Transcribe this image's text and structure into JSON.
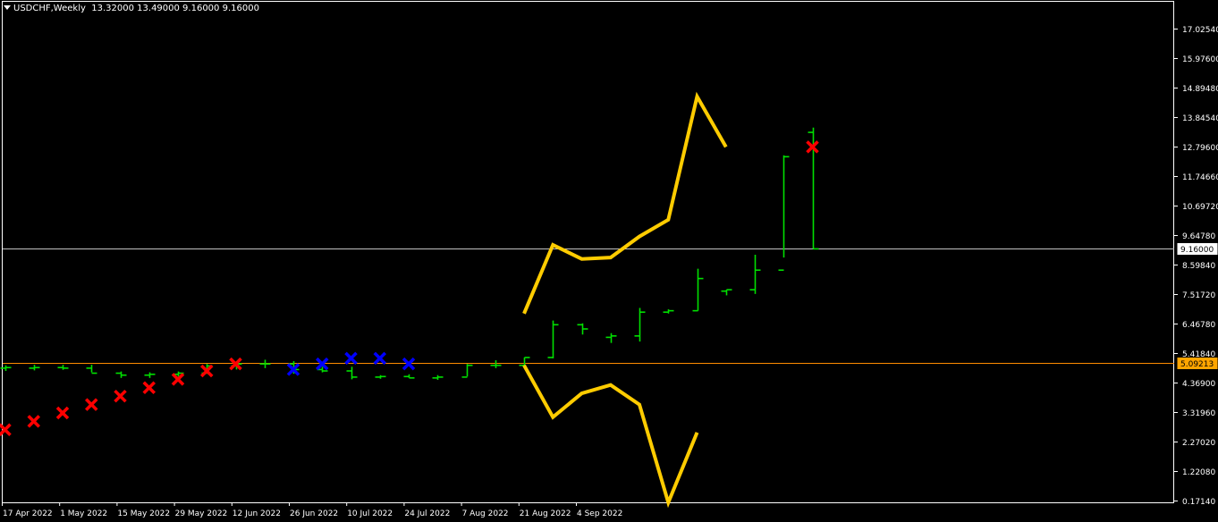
{
  "header": {
    "symbol": "USDCHF,Weekly",
    "ohlc": "13.32000 13.49000 9.16000 9.16000"
  },
  "colors": {
    "background": "#000000",
    "frame": "#ffffff",
    "bars": "#00e000",
    "bands": "#ffcc00",
    "sar_red": "#ff0000",
    "sar_blue": "#0000ff",
    "bid_line": "#c0c0c0",
    "ref_line": "#ff8c00",
    "label_highlight": "#ffa500"
  },
  "chart_data": {
    "type": "ohlc",
    "y_ticks": [
      "17.02540",
      "15.97600",
      "14.89480",
      "13.84540",
      "12.79600",
      "11.74660",
      "10.69720",
      "9.64780",
      "8.59840",
      "7.51720",
      "6.46780",
      "5.41840",
      "4.36900",
      "3.31960",
      "2.27020",
      "1.22080",
      "0.17140"
    ],
    "ylim": [
      0.0,
      18.0
    ],
    "x_labels": [
      "17 Apr 2022",
      "1 May 2022",
      "15 May 2022",
      "29 May 2022",
      "12 Jun 2022",
      "26 Jun 2022",
      "10 Jul 2022",
      "24 Jul 2022",
      "7 Aug 2022",
      "21 Aug 2022",
      "4 Sep 2022"
    ],
    "bars": [
      {
        "o": 4.9,
        "h": 5.0,
        "l": 4.8,
        "c": 4.92
      },
      {
        "o": 4.9,
        "h": 5.02,
        "l": 4.82,
        "c": 4.92
      },
      {
        "o": 4.92,
        "h": 5.02,
        "l": 4.84,
        "c": 4.9
      },
      {
        "o": 4.9,
        "h": 5.02,
        "l": 4.75,
        "c": 4.72
      },
      {
        "o": 4.72,
        "h": 4.78,
        "l": 4.55,
        "c": 4.65
      },
      {
        "o": 4.65,
        "h": 4.75,
        "l": 4.55,
        "c": 4.68
      },
      {
        "o": 4.68,
        "h": 4.78,
        "l": 4.6,
        "c": 4.72
      },
      {
        "o": 4.72,
        "h": 5.05,
        "l": 4.7,
        "c": 4.98
      },
      {
        "o": 4.98,
        "h": 5.1,
        "l": 4.85,
        "c": 5.05
      },
      {
        "o": 5.05,
        "h": 5.2,
        "l": 4.9,
        "c": 5.05
      },
      {
        "o": 5.05,
        "h": 5.15,
        "l": 4.7,
        "c": 4.85
      },
      {
        "o": 4.85,
        "h": 4.95,
        "l": 4.75,
        "c": 4.8
      },
      {
        "o": 4.8,
        "h": 4.95,
        "l": 4.5,
        "c": 4.58
      },
      {
        "o": 4.58,
        "h": 4.65,
        "l": 4.52,
        "c": 4.6
      },
      {
        "o": 4.6,
        "h": 4.68,
        "l": 4.55,
        "c": 4.55
      },
      {
        "o": 4.55,
        "h": 4.65,
        "l": 4.48,
        "c": 4.58
      },
      {
        "o": 4.58,
        "h": 5.05,
        "l": 4.6,
        "c": 5.0
      },
      {
        "o": 5.0,
        "h": 5.18,
        "l": 4.9,
        "c": 5.0
      },
      {
        "o": 5.0,
        "h": 5.28,
        "l": 4.95,
        "c": 5.28
      },
      {
        "o": 5.28,
        "h": 6.6,
        "l": 5.25,
        "c": 6.45
      },
      {
        "o": 6.45,
        "h": 6.5,
        "l": 6.1,
        "c": 6.3
      },
      {
        "o": 6.0,
        "h": 6.15,
        "l": 5.8,
        "c": 6.05
      },
      {
        "o": 6.05,
        "h": 7.05,
        "l": 5.85,
        "c": 6.9
      },
      {
        "o": 6.9,
        "h": 7.0,
        "l": 6.85,
        "c": 6.95
      },
      {
        "o": 6.95,
        "h": 8.45,
        "l": 6.95,
        "c": 8.1
      },
      {
        "o": 7.65,
        "h": 7.7,
        "l": 7.5,
        "c": 7.7
      },
      {
        "o": 7.7,
        "h": 8.95,
        "l": 7.55,
        "c": 8.4
      },
      {
        "o": 8.4,
        "h": 12.5,
        "l": 8.85,
        "c": 12.45
      },
      {
        "o": 13.32,
        "h": 13.49,
        "l": 9.16,
        "c": 9.16
      }
    ],
    "upper_band": [
      {
        "i": 18.0,
        "v": 6.85
      },
      {
        "i": 19.0,
        "v": 9.3
      },
      {
        "i": 20.0,
        "v": 8.8
      },
      {
        "i": 21.0,
        "v": 8.85
      },
      {
        "i": 22.0,
        "v": 9.6
      },
      {
        "i": 23.0,
        "v": 10.2
      },
      {
        "i": 24.0,
        "v": 14.6
      },
      {
        "i": 25.0,
        "v": 12.8
      }
    ],
    "lower_band": [
      {
        "i": 18.0,
        "v": 5.0
      },
      {
        "i": 19.0,
        "v": 3.15
      },
      {
        "i": 20.0,
        "v": 4.0
      },
      {
        "i": 21.0,
        "v": 4.3
      },
      {
        "i": 22.0,
        "v": 3.6
      },
      {
        "i": 23.0,
        "v": 0.1
      },
      {
        "i": 24.0,
        "v": 2.6
      }
    ],
    "sar": [
      {
        "i": 0,
        "v": 2.7,
        "color": "red"
      },
      {
        "i": 1,
        "v": 3.0,
        "color": "red"
      },
      {
        "i": 2,
        "v": 3.3,
        "color": "red"
      },
      {
        "i": 3,
        "v": 3.6,
        "color": "red"
      },
      {
        "i": 4,
        "v": 3.9,
        "color": "red"
      },
      {
        "i": 5,
        "v": 4.2,
        "color": "red"
      },
      {
        "i": 6,
        "v": 4.5,
        "color": "red"
      },
      {
        "i": 7,
        "v": 4.8,
        "color": "red"
      },
      {
        "i": 8,
        "v": 5.05,
        "color": "red"
      },
      {
        "i": 10,
        "v": 4.85,
        "color": "blue"
      },
      {
        "i": 11,
        "v": 5.05,
        "color": "blue"
      },
      {
        "i": 12,
        "v": 5.25,
        "color": "blue"
      },
      {
        "i": 13,
        "v": 5.25,
        "color": "blue"
      },
      {
        "i": 14,
        "v": 5.05,
        "color": "blue"
      },
      {
        "i": 28,
        "v": 12.8,
        "color": "red"
      }
    ],
    "bid_line": {
      "value": 9.16,
      "label": "9.16000"
    },
    "ref_line": {
      "value": 5.09213,
      "label": "5.09213"
    }
  }
}
